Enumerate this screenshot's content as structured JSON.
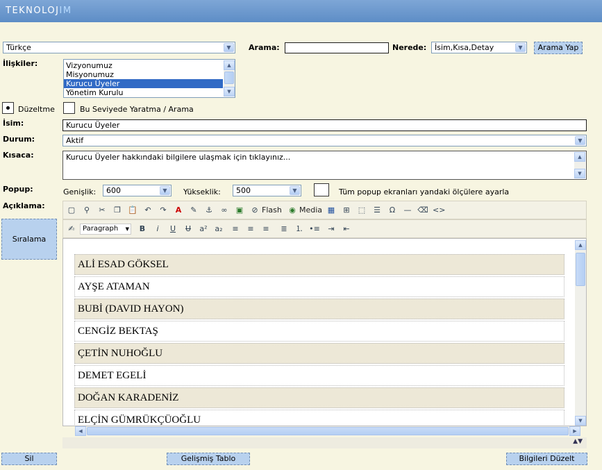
{
  "header": {
    "logo_prefix": "TEKNOLOJ",
    "logo_suffix": "IM"
  },
  "top": {
    "language": "Türkçe",
    "search_label": "Arama:",
    "search_value": "",
    "where_label": "Nerede:",
    "where_value": "İsim,Kısa,Detay",
    "search_button": "Arama Yap"
  },
  "relations": {
    "label": "İlişkiler:",
    "items": [
      "Vizyonumuz",
      "Misyonumuz",
      "Kurucu Üyeler",
      "Yönetim Kurulu"
    ],
    "selected": "Kurucu Üyeler"
  },
  "mode": {
    "edit_label": "Düzeltme",
    "create_label": "Bu Seviyede Yaratma / Arama"
  },
  "form": {
    "name_label": "İsim:",
    "name_value": "Kurucu Üyeler",
    "status_label": "Durum:",
    "status_value": "Aktif",
    "short_label": "Kısaca:",
    "short_value": "Kurucu Üyeler hakkındaki bilgilere ulaşmak için tıklayınız...",
    "popup_label": "Popup:",
    "width_label": "Genişlik:",
    "width_value": "600",
    "height_label": "Yükseklik:",
    "height_value": "500",
    "popup_all_label": "Tüm popup ekranları yandaki ölçülere ayarla",
    "desc_label": "Açıklama:",
    "order_button": "Sıralama"
  },
  "editor": {
    "flash_label": "Flash",
    "media_label": "Media",
    "format_value": "Paragraph",
    "rows": [
      "ALİ ESAD GÖKSEL",
      "AYŞE ATAMAN",
      "BUBİ (DAVID HAYON)",
      "CENGİZ BEKTAŞ",
      "ÇETİN NUHOĞLU",
      "DEMET EGELİ",
      "DOĞAN KARADENİZ",
      "ELÇİN GÜMRÜKÇÜOĞLU"
    ]
  },
  "footer": {
    "delete_button": "Sil",
    "advanced_table_button": "Gelişmiş Tablo",
    "update_button": "Bilgileri Düzelt"
  }
}
